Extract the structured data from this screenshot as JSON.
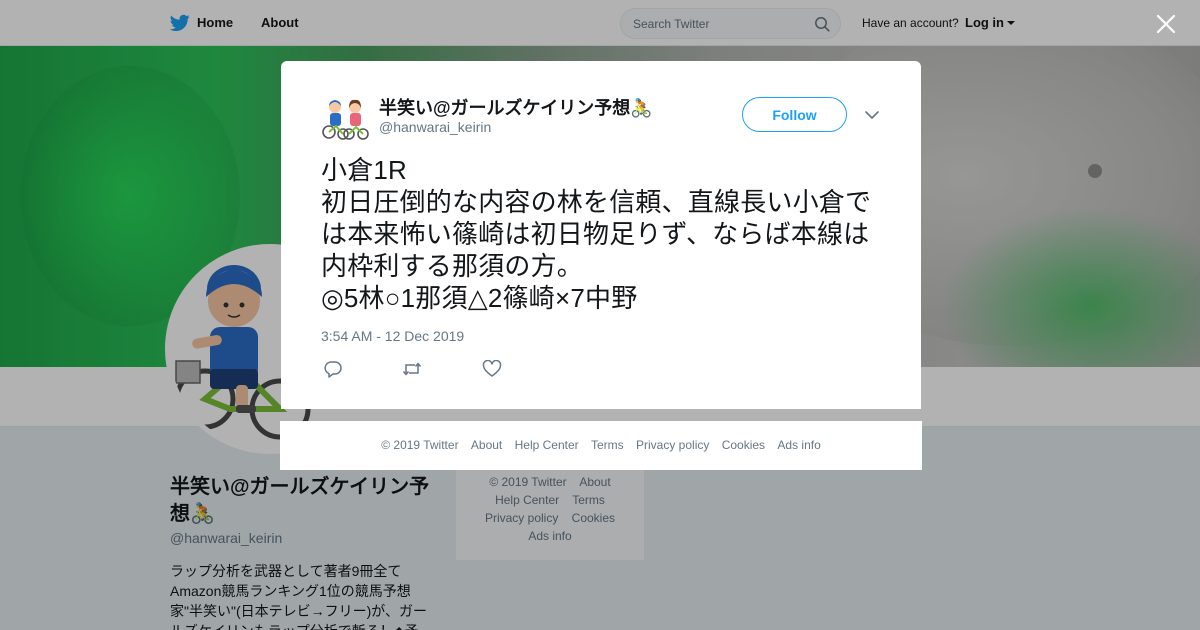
{
  "nav": {
    "home_label": "Home",
    "about_label": "About",
    "search_placeholder": "Search Twitter",
    "have_account": "Have an account?",
    "login_label": "Log in"
  },
  "profile": {
    "name": "半笑い@ガールズケイリン予想🚴",
    "handle": "@hanwarai_keirin",
    "bio": "ラップ分析を武器として著者9冊全てAmazon競馬ランキング1位の競馬予想家\"半笑い\"(日本テレビ→フリー)が、ガールズケイリンもラップ分析で斬る！◆予"
  },
  "side_footer": {
    "line1": [
      "© 2019 Twitter",
      "About"
    ],
    "line2": [
      "Help Center",
      "Terms"
    ],
    "line3": [
      "Privacy policy",
      "Cookies"
    ],
    "line4": [
      "Ads info"
    ]
  },
  "tweet": {
    "name": "半笑い@ガールズケイリン予想🚴",
    "handle": "@hanwarai_keirin",
    "follow_label": "Follow",
    "text": "小倉1R\n初日圧倒的な内容の林を信頼、直線長い小倉では本来怖い篠崎は初日物足りず、ならば本線は内枠利する那須の方。\n◎5林○1那須△2篠崎×7中野",
    "timestamp": "3:54 AM - 12 Dec 2019"
  },
  "modal_footer": {
    "links": [
      "© 2019 Twitter",
      "About",
      "Help Center",
      "Terms",
      "Privacy policy",
      "Cookies",
      "Ads info"
    ]
  },
  "colors": {
    "accent": "#1da1f2",
    "text": "#14171a",
    "muted": "#657786"
  },
  "icons": [
    "twitter-bird-icon",
    "search-icon",
    "caret-down-icon",
    "close-icon",
    "reply-icon",
    "retweet-icon",
    "heart-icon"
  ]
}
